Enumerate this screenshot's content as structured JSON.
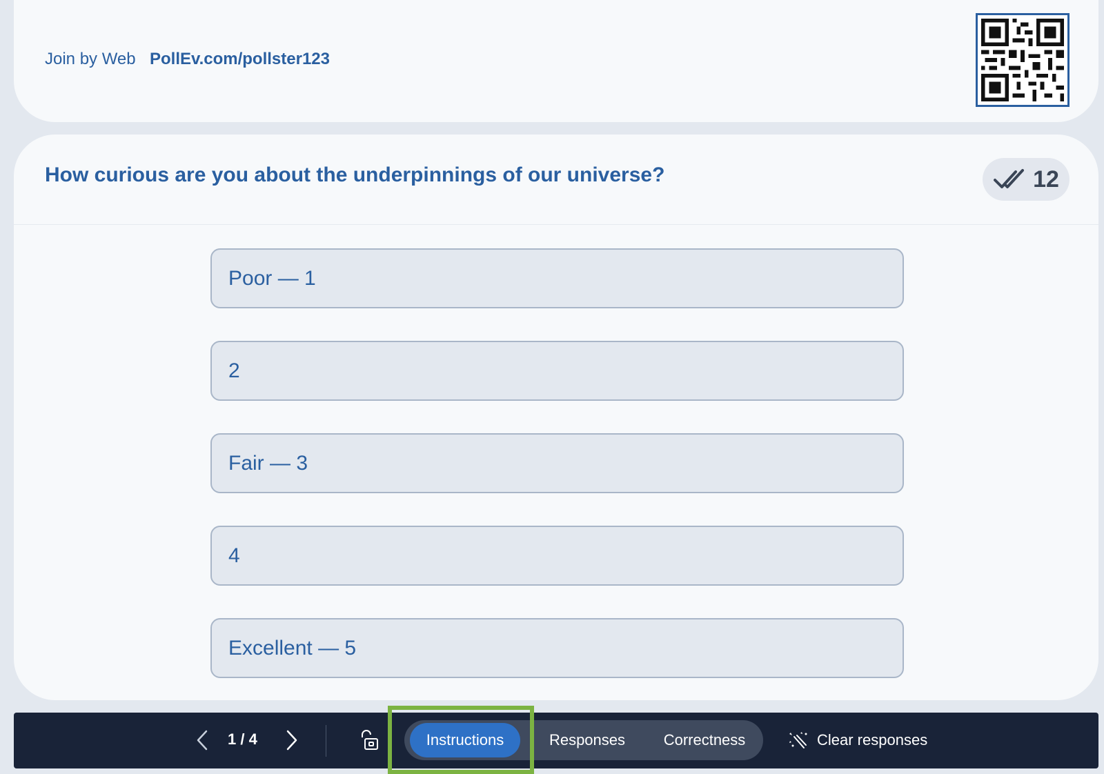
{
  "join": {
    "label": "Join by Web",
    "url": "PollEv.com/pollster123"
  },
  "poll": {
    "question": "How curious are you about the underpinnings of our universe?",
    "response_count": "12",
    "options": [
      {
        "label": "Poor — 1"
      },
      {
        "label": "2"
      },
      {
        "label": "Fair — 3"
      },
      {
        "label": "4"
      },
      {
        "label": "Excellent — 5"
      }
    ]
  },
  "toolbar": {
    "page_indicator": "1 / 4",
    "tabs": {
      "instructions": "Instructions",
      "responses": "Responses",
      "correctness": "Correctness"
    },
    "active_tab": "instructions",
    "clear_label": "Clear responses"
  },
  "colors": {
    "accent": "#2a5fa0",
    "active_tab": "#2e71c6",
    "toolbar_bg": "#192338",
    "highlight": "#7cb342"
  },
  "icons": {
    "qr": "qr-code-icon",
    "responses": "double-check-icon",
    "prev": "chevron-left-icon",
    "next": "chevron-right-icon",
    "lock": "unlock-icon",
    "clear": "clear-sparkle-icon"
  }
}
